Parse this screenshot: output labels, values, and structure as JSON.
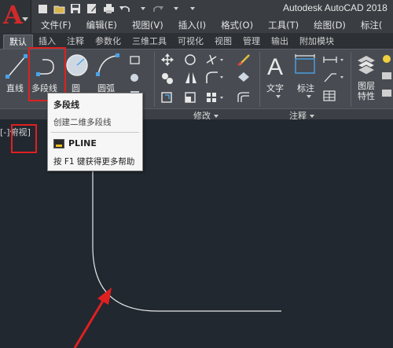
{
  "title_bar": {
    "title": "Autodesk AutoCAD 2018"
  },
  "app_menu": {
    "logo": "A"
  },
  "quick_access": [
    "new-file-icon",
    "open-folder-icon",
    "save-icon",
    "save-as-icon",
    "print-icon",
    "undo-icon",
    "redo-icon"
  ],
  "menu_bar": {
    "items": [
      "文件(F)",
      "编辑(E)",
      "视图(V)",
      "插入(I)",
      "格式(O)",
      "工具(T)",
      "绘图(D)",
      "标注("
    ]
  },
  "ribbon_tabs": {
    "active": "默认",
    "items": [
      "默认",
      "插入",
      "注释",
      "参数化",
      "三维工具",
      "可视化",
      "视图",
      "管理",
      "输出",
      "附加模块"
    ]
  },
  "ribbon": {
    "draw": {
      "line": "直线",
      "polyline": "多段线",
      "circle": "圆",
      "arc": "圆弧"
    },
    "modify_panel": "修改",
    "annotation": {
      "text": "文字",
      "dimension": "标注",
      "panel": "注释"
    },
    "layer": {
      "label": "图层\n特性"
    }
  },
  "tooltip": {
    "title": "多段线",
    "description": "创建二维多段线",
    "command": "PLINE",
    "help": "按 F1 键获得更多帮助"
  },
  "viewport": {
    "prefix": "[-]",
    "view": "俯视",
    "suffix": "]"
  },
  "colors": {
    "background": "#212830",
    "ribbon": "#484c52",
    "accent_red": "#e02020",
    "logo_red": "#d12a2a",
    "drawing_line": "#e8e8e8"
  }
}
